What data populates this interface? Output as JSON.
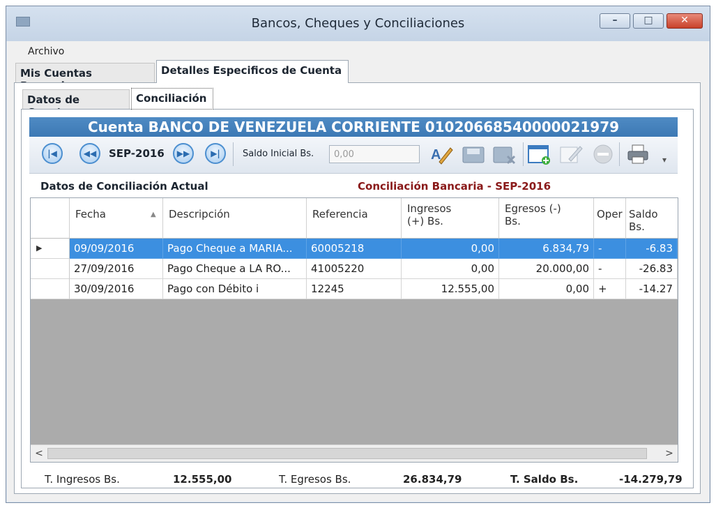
{
  "window": {
    "title": "Bancos, Cheques y Conciliaciones",
    "controls": [
      "–",
      "□",
      "✕"
    ]
  },
  "menu": {
    "file": "Archivo"
  },
  "tabs": {
    "main": [
      "Mis Cuentas Bancarias",
      "Detalles Especificos de Cuenta"
    ],
    "sub": [
      "Datos de Cuenta",
      "Conciliación"
    ]
  },
  "account_header": "Cuenta BANCO DE VENEZUELA CORRIENTE 01020668540000021979",
  "toolbar": {
    "period": "SEP-2016",
    "nav_first": "|◀",
    "nav_prev": "◀◀",
    "nav_next": "▶▶",
    "nav_last": "▶|",
    "saldo_label": "Saldo Inicial Bs.",
    "saldo_value": "0,00",
    "more": "▾"
  },
  "section": {
    "left": "Datos de Conciliación Actual",
    "right": "Conciliación Bancaria - SEP-2016"
  },
  "grid": {
    "headers": [
      "Fecha",
      "Descripción",
      "Referencia",
      "Ingresos\n(+) Bs.",
      "Egresos (-)\nBs.",
      "Oper",
      "Saldo Bs."
    ],
    "sort_glyph": "▲",
    "rows": [
      {
        "marker": "▶",
        "fecha": "09/09/2016",
        "descripcion": "Pago Cheque a MARIA...",
        "referencia": "60005218",
        "ingresos": "0,00",
        "egresos": "6.834,79",
        "oper": "-",
        "saldo": "-6.83"
      },
      {
        "marker": "",
        "fecha": "27/09/2016",
        "descripcion": "Pago Cheque a LA RO...",
        "referencia": "41005220",
        "ingresos": "0,00",
        "egresos": "20.000,00",
        "oper": "-",
        "saldo": "-26.83"
      },
      {
        "marker": "",
        "fecha": "30/09/2016",
        "descripcion": "Pago con Débito i",
        "referencia": "12245",
        "ingresos": "12.555,00",
        "egresos": "0,00",
        "oper": "+",
        "saldo": "-14.27"
      }
    ],
    "scroll_left": "<",
    "scroll_right": ">"
  },
  "totals": {
    "ingresos_label": "T. Ingresos Bs.",
    "ingresos_value": "12.555,00",
    "egresos_label": "T. Egresos Bs.",
    "egresos_value": "26.834,79",
    "saldo_label": "T. Saldo Bs.",
    "saldo_value": "-14.279,79"
  }
}
